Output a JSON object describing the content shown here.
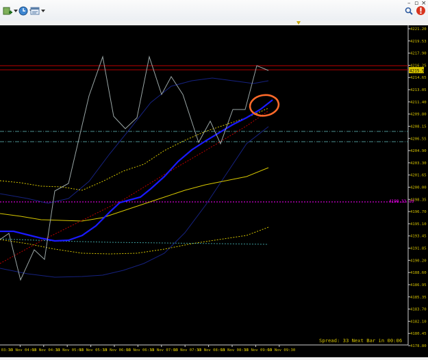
{
  "window": {
    "controls": [
      "–",
      "▫",
      "×"
    ]
  },
  "toolbar": {
    "icons": [
      "add-indicator-icon",
      "clock-icon",
      "template-icon"
    ],
    "right_icons": [
      "search-icon",
      "notification-icon"
    ]
  },
  "chart": {
    "price_axis": [
      "4221.20",
      "4219.53",
      "4217.90",
      "4216.25",
      "4214.65",
      "4213.05",
      "4211.40",
      "4209.80",
      "4208.15",
      "4206.55",
      "4204.90",
      "4203.30",
      "4201.65",
      "4200.00",
      "4198.35",
      "4196.70",
      "4195.10",
      "4193.45",
      "4191.85",
      "4190.20",
      "4188.60",
      "4186.95",
      "4185.35",
      "4183.70",
      "4182.10",
      "4180.45",
      "4178.80"
    ],
    "current_price": "4215.58",
    "horizontal_label": "4198.33 ud",
    "time_axis": [
      "13 Nov 03:30",
      "13 Nov 04:00",
      "13 Nov 04:30",
      "13 Nov 05:00",
      "13 Nov 05:30",
      "13 Nov 06:00",
      "13 Nov 06:30",
      "13 Nov 07:00",
      "13 Nov 07:30",
      "13 Nov 08:00",
      "13 Nov 08:30",
      "13 Nov 09:00",
      "13 Nov 09:30"
    ],
    "status_text": "Spread: 33  Next Bar in 00:06",
    "colors": {
      "background": "#000000",
      "axis_text": "#d6c300",
      "price_line": "#9aa6a6",
      "ma_blue": "#1a1aff",
      "ma_yellow": "#d8c800",
      "red_line": "#c00000",
      "circle": "#ff6a2a",
      "magenta": "#ff00ff",
      "teal": "#5fb3b3"
    }
  }
}
